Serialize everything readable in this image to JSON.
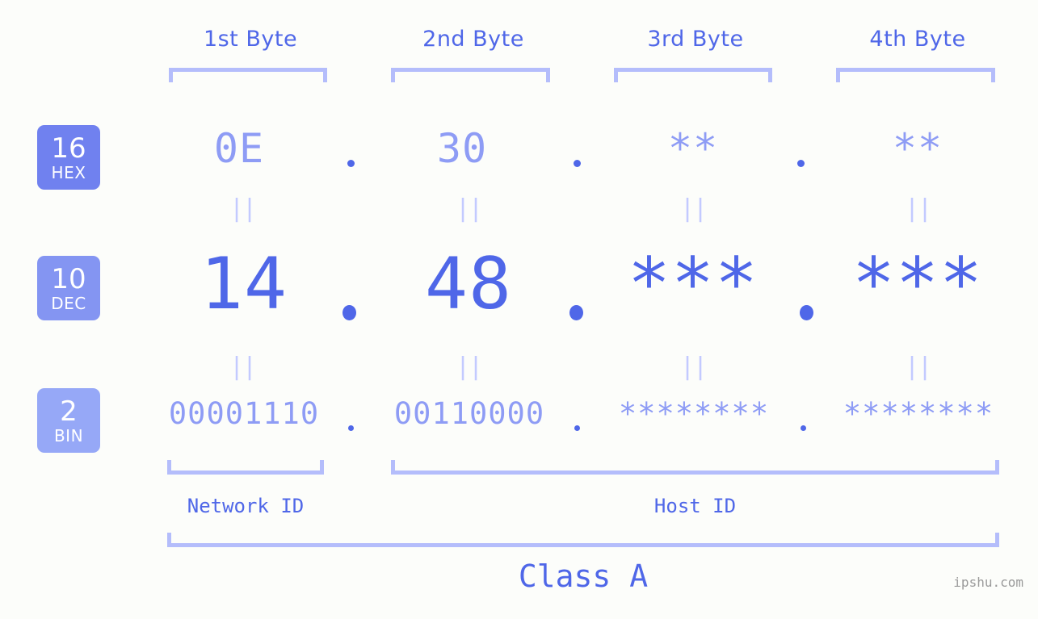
{
  "background_color": "#fcfdfa",
  "colors": {
    "accent_strong": "#4f67e8",
    "accent_light": "#8e9cf5",
    "bracket": "#b4bdfb",
    "equals": "#c3caff",
    "badge_hex": "#7081ef",
    "badge_dec": "#8495f2",
    "badge_bin": "#96a8f7",
    "watermark": "#9a9a9a"
  },
  "byte_headers": [
    {
      "label": "1st Byte"
    },
    {
      "label": "2nd Byte"
    },
    {
      "label": "3rd Byte"
    },
    {
      "label": "4th Byte"
    }
  ],
  "bases": [
    {
      "id": "hex",
      "number": "16",
      "name": "HEX"
    },
    {
      "id": "dec",
      "number": "10",
      "name": "DEC"
    },
    {
      "id": "bin",
      "number": "2",
      "name": "BIN"
    }
  ],
  "rows": {
    "hex": {
      "values": [
        "0E",
        "30",
        "**",
        "**"
      ],
      "separator": "."
    },
    "dec": {
      "values": [
        "14",
        "48",
        "***",
        "***"
      ],
      "separator": "."
    },
    "bin": {
      "values": [
        "00001110",
        "00110000",
        "********",
        "********"
      ],
      "separator": "."
    }
  },
  "equals_marker": "||",
  "segments": {
    "network_id": {
      "label": "Network ID"
    },
    "host_id": {
      "label": "Host ID"
    }
  },
  "class": {
    "label": "Class A"
  },
  "watermark": {
    "text": "ipshu.com"
  }
}
